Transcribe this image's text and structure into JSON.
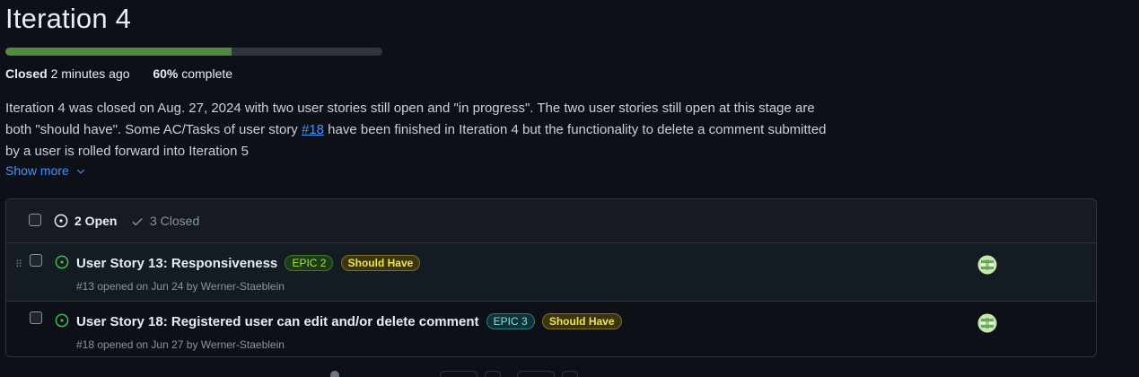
{
  "milestone": {
    "title": "Iteration 4",
    "progress_fraction": 0.6,
    "status_label": "Closed",
    "closed_ago": "2 minutes ago",
    "percent": "60%",
    "percent_suffix": "complete",
    "description_part1": "Iteration 4 was closed on Aug. 27, 2024 with two user stories still open and \"in progress\". The two user stories still open at this stage are both \"should have\". Some AC/Tasks of user story ",
    "description_link": "#18",
    "description_part2": " have been finished in Iteration 4 but the functionality to delete a comment submitted by a user is rolled forward into Iteration 5",
    "show_more_label": "Show more",
    "colors": {
      "progress": "#4f8a43",
      "link": "#4493f8",
      "open_icon": "#3fb950"
    }
  },
  "issues_header": {
    "open_label": "2 Open",
    "closed_label": "3 Closed"
  },
  "issues": [
    {
      "title": "User Story 13: Responsiveness",
      "labels": [
        "EPIC 2",
        "Should Have"
      ],
      "meta": "#13 opened on Jun 24 by Werner-Staeblein"
    },
    {
      "title": "User Story 18: Registered user can edit and/or delete comment",
      "labels": [
        "EPIC 3",
        "Should Have"
      ],
      "meta": "#18 opened on Jun 27 by Werner-Staeblein"
    }
  ]
}
